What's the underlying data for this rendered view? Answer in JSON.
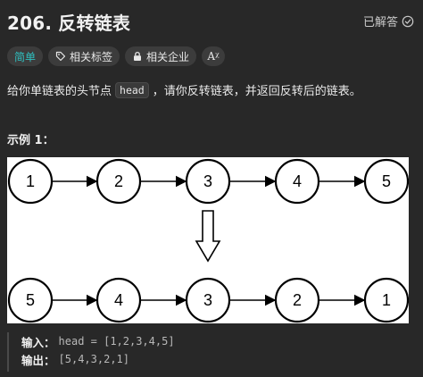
{
  "header": {
    "title": "206. 反转链表",
    "status_label": "已解答",
    "status_icon": "check-circle-icon"
  },
  "tags": {
    "difficulty": "简单",
    "topics_label": "相关标签",
    "topics_icon": "tag-icon",
    "companies_label": "相关企业",
    "companies_icon": "lock-icon",
    "font_label": "Aᵡ",
    "font_icon": "font-size-icon"
  },
  "description": {
    "before": "给你单链表的头节点",
    "code": "head",
    "after": "，请你反转链表，并返回反转后的链表。"
  },
  "example": {
    "title": "示例 1：",
    "input_label": "输入：",
    "input_value": "head = [1,2,3,4,5]",
    "output_label": "输出：",
    "output_value": "[5,4,3,2,1]"
  },
  "diagram": {
    "top_nodes": [
      "1",
      "2",
      "3",
      "4",
      "5"
    ],
    "bottom_nodes": [
      "5",
      "4",
      "3",
      "2",
      "1"
    ],
    "arrow_icon": "down-arrow-icon"
  },
  "colors": {
    "background": "#282828",
    "easy": "#2fc0c0",
    "tag_bg": "#3c3c3c"
  }
}
